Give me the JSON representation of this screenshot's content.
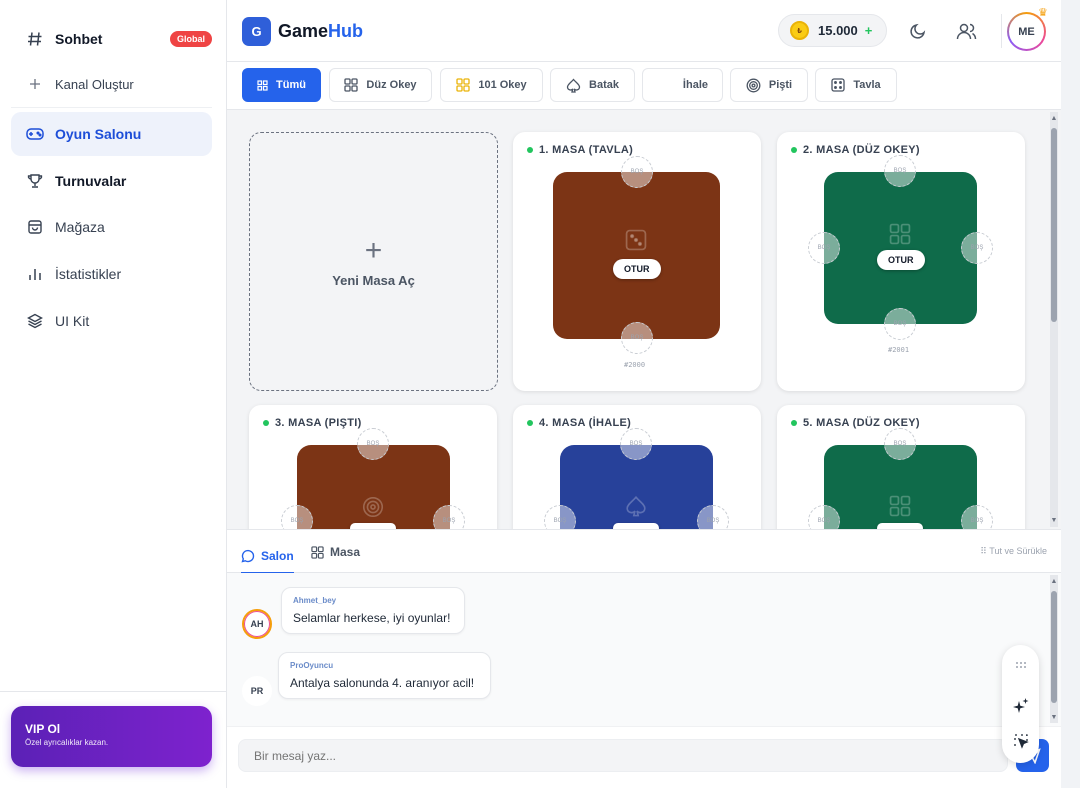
{
  "sidebar": {
    "items": [
      {
        "label": "Sohbet",
        "icon": "hash-icon"
      },
      {
        "label": "Kanal Oluştur",
        "icon": "plus-icon"
      },
      {
        "label": "Oyun Salonu",
        "icon": "gamepad-icon"
      },
      {
        "label": "Turnuvalar",
        "icon": "trophy-icon"
      },
      {
        "label": "Mağaza",
        "icon": "shopping-bag-icon"
      },
      {
        "label": "İstatistikler",
        "icon": "bar-chart-icon"
      },
      {
        "label": "UI Kit",
        "icon": "layers-icon"
      }
    ],
    "global_badge": "Global",
    "vip": {
      "title": "VIP Ol",
      "subtitle": "Özel ayrıcalıklar kazan."
    }
  },
  "header": {
    "logo_letter": "G",
    "logo_game": "Game",
    "logo_hub": "Hub",
    "coins": "15.000",
    "coin_plus": "+",
    "avatar": "ME"
  },
  "filters": [
    {
      "label": "Tümü",
      "active": true
    },
    {
      "label": "Düz Okey"
    },
    {
      "label": "101 Okey"
    },
    {
      "label": "Batak"
    },
    {
      "label": "İhale"
    },
    {
      "label": "Pişti"
    },
    {
      "label": "Tavla"
    }
  ],
  "content": {
    "new_table_label": "Yeni Masa Aç",
    "new_table_plus": "+",
    "tables": [
      {
        "title": "1. MASA (TAVLA)",
        "button": "OTUR",
        "code": "#2000",
        "seat": "BOŞ",
        "color": "#7c3415"
      },
      {
        "title": "2. MASA (DÜZ OKEY)",
        "button": "OTUR",
        "code": "#2001",
        "seat": "BOŞ",
        "color": "#0f6b4a"
      },
      {
        "title": "3. MASA (PIŞTI)",
        "seat": "BOŞ",
        "color": "#7c3415"
      },
      {
        "title": "4. MASA (İHALE)",
        "seat": "BOŞ",
        "color": "#27419a"
      },
      {
        "title": "5. MASA (DÜZ OKEY)",
        "seat": "BOŞ",
        "color": "#0f6b4a"
      }
    ]
  },
  "chat": {
    "tabs": [
      {
        "label": "Salon",
        "active": true
      },
      {
        "label": "Masa"
      }
    ],
    "drag_hint": "Tut ve Sürükle",
    "messages": [
      {
        "avatar": "AH",
        "author": "Ahmet_bey",
        "text": "Selamlar herkese, iyi oyunlar!"
      },
      {
        "avatar": "PR",
        "author": "ProOyuncu",
        "text": "Antalya salonunda 4. aranıyor acil!"
      }
    ],
    "input_placeholder": "Bir mesaj yaz..."
  },
  "colors": {
    "accent": "#2563eb",
    "online": "#22c55e",
    "badge": "#ef4444",
    "vip": "#6d28d9"
  }
}
